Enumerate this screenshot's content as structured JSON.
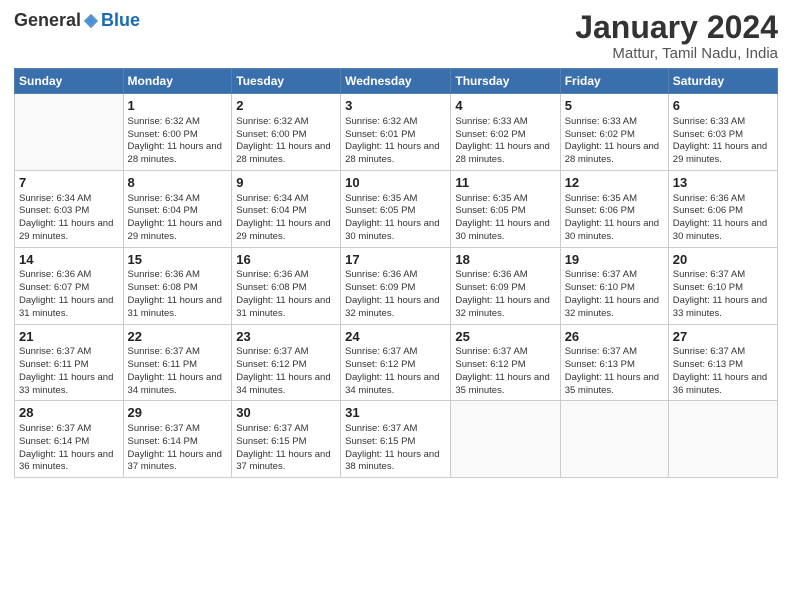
{
  "logo": {
    "general": "General",
    "blue": "Blue"
  },
  "header": {
    "title": "January 2024",
    "subtitle": "Mattur, Tamil Nadu, India"
  },
  "weekdays": [
    "Sunday",
    "Monday",
    "Tuesday",
    "Wednesday",
    "Thursday",
    "Friday",
    "Saturday"
  ],
  "weeks": [
    [
      {
        "day": "",
        "info": ""
      },
      {
        "day": "1",
        "info": "Sunrise: 6:32 AM\nSunset: 6:00 PM\nDaylight: 11 hours\nand 28 minutes."
      },
      {
        "day": "2",
        "info": "Sunrise: 6:32 AM\nSunset: 6:00 PM\nDaylight: 11 hours\nand 28 minutes."
      },
      {
        "day": "3",
        "info": "Sunrise: 6:32 AM\nSunset: 6:01 PM\nDaylight: 11 hours\nand 28 minutes."
      },
      {
        "day": "4",
        "info": "Sunrise: 6:33 AM\nSunset: 6:02 PM\nDaylight: 11 hours\nand 28 minutes."
      },
      {
        "day": "5",
        "info": "Sunrise: 6:33 AM\nSunset: 6:02 PM\nDaylight: 11 hours\nand 28 minutes."
      },
      {
        "day": "6",
        "info": "Sunrise: 6:33 AM\nSunset: 6:03 PM\nDaylight: 11 hours\nand 29 minutes."
      }
    ],
    [
      {
        "day": "7",
        "info": "Sunrise: 6:34 AM\nSunset: 6:03 PM\nDaylight: 11 hours\nand 29 minutes."
      },
      {
        "day": "8",
        "info": "Sunrise: 6:34 AM\nSunset: 6:04 PM\nDaylight: 11 hours\nand 29 minutes."
      },
      {
        "day": "9",
        "info": "Sunrise: 6:34 AM\nSunset: 6:04 PM\nDaylight: 11 hours\nand 29 minutes."
      },
      {
        "day": "10",
        "info": "Sunrise: 6:35 AM\nSunset: 6:05 PM\nDaylight: 11 hours\nand 30 minutes."
      },
      {
        "day": "11",
        "info": "Sunrise: 6:35 AM\nSunset: 6:05 PM\nDaylight: 11 hours\nand 30 minutes."
      },
      {
        "day": "12",
        "info": "Sunrise: 6:35 AM\nSunset: 6:06 PM\nDaylight: 11 hours\nand 30 minutes."
      },
      {
        "day": "13",
        "info": "Sunrise: 6:36 AM\nSunset: 6:06 PM\nDaylight: 11 hours\nand 30 minutes."
      }
    ],
    [
      {
        "day": "14",
        "info": "Sunrise: 6:36 AM\nSunset: 6:07 PM\nDaylight: 11 hours\nand 31 minutes."
      },
      {
        "day": "15",
        "info": "Sunrise: 6:36 AM\nSunset: 6:08 PM\nDaylight: 11 hours\nand 31 minutes."
      },
      {
        "day": "16",
        "info": "Sunrise: 6:36 AM\nSunset: 6:08 PM\nDaylight: 11 hours\nand 31 minutes."
      },
      {
        "day": "17",
        "info": "Sunrise: 6:36 AM\nSunset: 6:09 PM\nDaylight: 11 hours\nand 32 minutes."
      },
      {
        "day": "18",
        "info": "Sunrise: 6:36 AM\nSunset: 6:09 PM\nDaylight: 11 hours\nand 32 minutes."
      },
      {
        "day": "19",
        "info": "Sunrise: 6:37 AM\nSunset: 6:10 PM\nDaylight: 11 hours\nand 32 minutes."
      },
      {
        "day": "20",
        "info": "Sunrise: 6:37 AM\nSunset: 6:10 PM\nDaylight: 11 hours\nand 33 minutes."
      }
    ],
    [
      {
        "day": "21",
        "info": "Sunrise: 6:37 AM\nSunset: 6:11 PM\nDaylight: 11 hours\nand 33 minutes."
      },
      {
        "day": "22",
        "info": "Sunrise: 6:37 AM\nSunset: 6:11 PM\nDaylight: 11 hours\nand 34 minutes."
      },
      {
        "day": "23",
        "info": "Sunrise: 6:37 AM\nSunset: 6:12 PM\nDaylight: 11 hours\nand 34 minutes."
      },
      {
        "day": "24",
        "info": "Sunrise: 6:37 AM\nSunset: 6:12 PM\nDaylight: 11 hours\nand 34 minutes."
      },
      {
        "day": "25",
        "info": "Sunrise: 6:37 AM\nSunset: 6:12 PM\nDaylight: 11 hours\nand 35 minutes."
      },
      {
        "day": "26",
        "info": "Sunrise: 6:37 AM\nSunset: 6:13 PM\nDaylight: 11 hours\nand 35 minutes."
      },
      {
        "day": "27",
        "info": "Sunrise: 6:37 AM\nSunset: 6:13 PM\nDaylight: 11 hours\nand 36 minutes."
      }
    ],
    [
      {
        "day": "28",
        "info": "Sunrise: 6:37 AM\nSunset: 6:14 PM\nDaylight: 11 hours\nand 36 minutes."
      },
      {
        "day": "29",
        "info": "Sunrise: 6:37 AM\nSunset: 6:14 PM\nDaylight: 11 hours\nand 37 minutes."
      },
      {
        "day": "30",
        "info": "Sunrise: 6:37 AM\nSunset: 6:15 PM\nDaylight: 11 hours\nand 37 minutes."
      },
      {
        "day": "31",
        "info": "Sunrise: 6:37 AM\nSunset: 6:15 PM\nDaylight: 11 hours\nand 38 minutes."
      },
      {
        "day": "",
        "info": ""
      },
      {
        "day": "",
        "info": ""
      },
      {
        "day": "",
        "info": ""
      }
    ]
  ]
}
